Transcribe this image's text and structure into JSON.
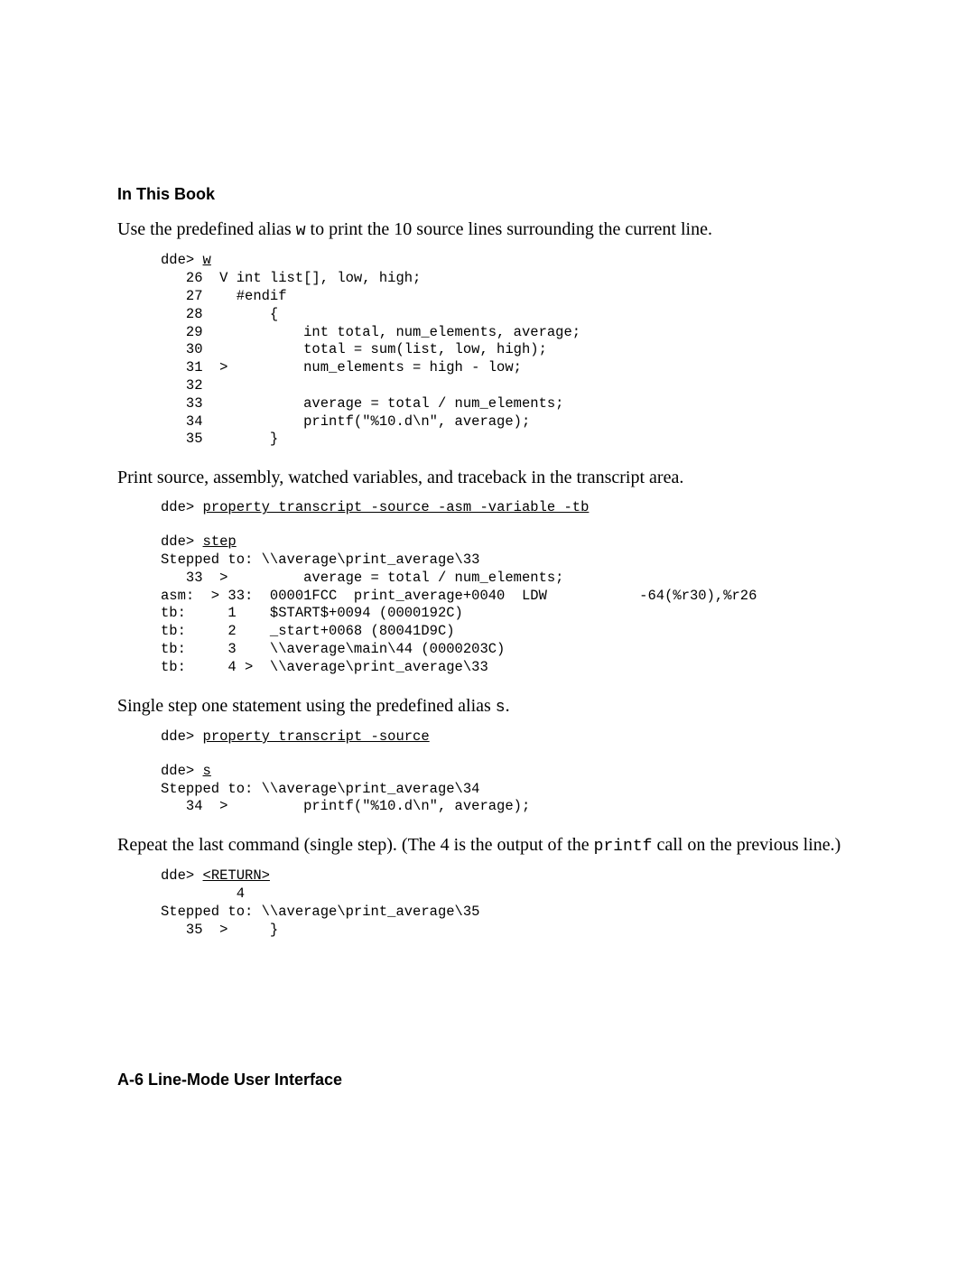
{
  "header": "In This Book",
  "para1_a": "Use the predefined alias ",
  "para1_code": "w",
  "para1_b": " to print the 10 source lines surrounding the current line.",
  "block1": {
    "prompt": "dde> ",
    "cmd": "w",
    "lines": "   26  V int list[], low, high;\n   27    #endif\n   28        {\n   29            int total, num_elements, average;\n   30            total = sum(list, low, high);\n   31  >         num_elements = high - low;\n   32\n   33            average = total / num_elements;\n   34            printf(\"%10.d\\n\", average);\n   35        }"
  },
  "para2": "Print source, assembly, watched variables, and traceback in the transcript area.",
  "block2": {
    "prompt": "dde> ",
    "cmd": "property transcript -source -asm -variable -tb"
  },
  "block3": {
    "prompt": "dde> ",
    "cmd": "step",
    "lines": "Stepped to: \\\\average\\print_average\\33\n   33  >         average = total / num_elements;\nasm:  > 33:  00001FCC  print_average+0040  LDW           -64(%r30),%r26\ntb:     1    $START$+0094 (0000192C)\ntb:     2    _start+0068 (80041D9C)\ntb:     3    \\\\average\\main\\44 (0000203C)\ntb:     4 >  \\\\average\\print_average\\33"
  },
  "para3_a": "Single step one statement using the predefined alias ",
  "para3_code": "s",
  "para3_b": ".",
  "block4": {
    "prompt": "dde> ",
    "cmd": "property transcript -source"
  },
  "block5": {
    "prompt": "dde> ",
    "cmd": "s",
    "lines": "Stepped to: \\\\average\\print_average\\34\n   34  >         printf(\"%10.d\\n\", average);"
  },
  "para4_a": "Repeat the last command (single step). (The 4 is the output of the ",
  "para4_code": "printf",
  "para4_b": " call on the previous line.)",
  "block6": {
    "prompt": "dde> ",
    "cmd": "<RETURN>",
    "lines": "         4\nStepped to: \\\\average\\print_average\\35\n   35  >     }"
  },
  "footer": "A-6   Line-Mode User Interface"
}
